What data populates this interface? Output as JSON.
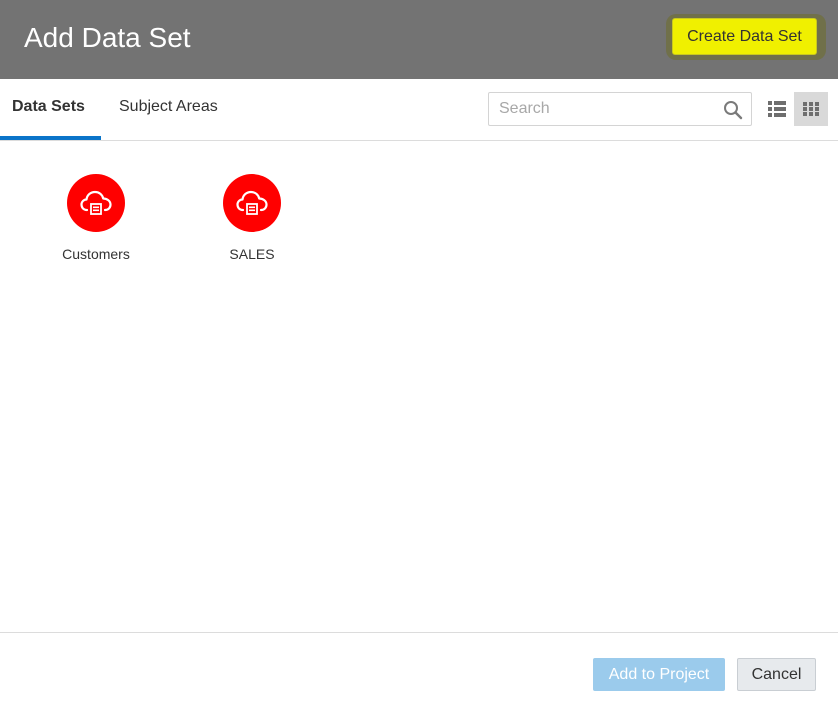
{
  "header": {
    "title": "Add Data Set",
    "create_button_label": "Create Data Set",
    "create_button_highlight_color": "#f0f000"
  },
  "tabs": [
    {
      "label": "Data Sets",
      "active": true
    },
    {
      "label": "Subject Areas",
      "active": false
    }
  ],
  "search": {
    "placeholder": "Search",
    "value": "",
    "icon": "search-icon"
  },
  "view_toggle": {
    "options": [
      {
        "icon": "list-view-icon",
        "selected": false
      },
      {
        "icon": "grid-view-icon",
        "selected": true
      }
    ]
  },
  "datasets": [
    {
      "label": "Customers",
      "icon": "cloud-database-icon"
    },
    {
      "label": "SALES",
      "icon": "cloud-database-icon"
    }
  ],
  "footer": {
    "add_button_label": "Add to Project",
    "add_button_enabled": false,
    "cancel_button_label": "Cancel"
  },
  "colors": {
    "header_bg": "#737373",
    "accent": "#0a74c9",
    "dataset_icon_bg": "#ff0000",
    "primary_disabled": "#9bcbec"
  }
}
